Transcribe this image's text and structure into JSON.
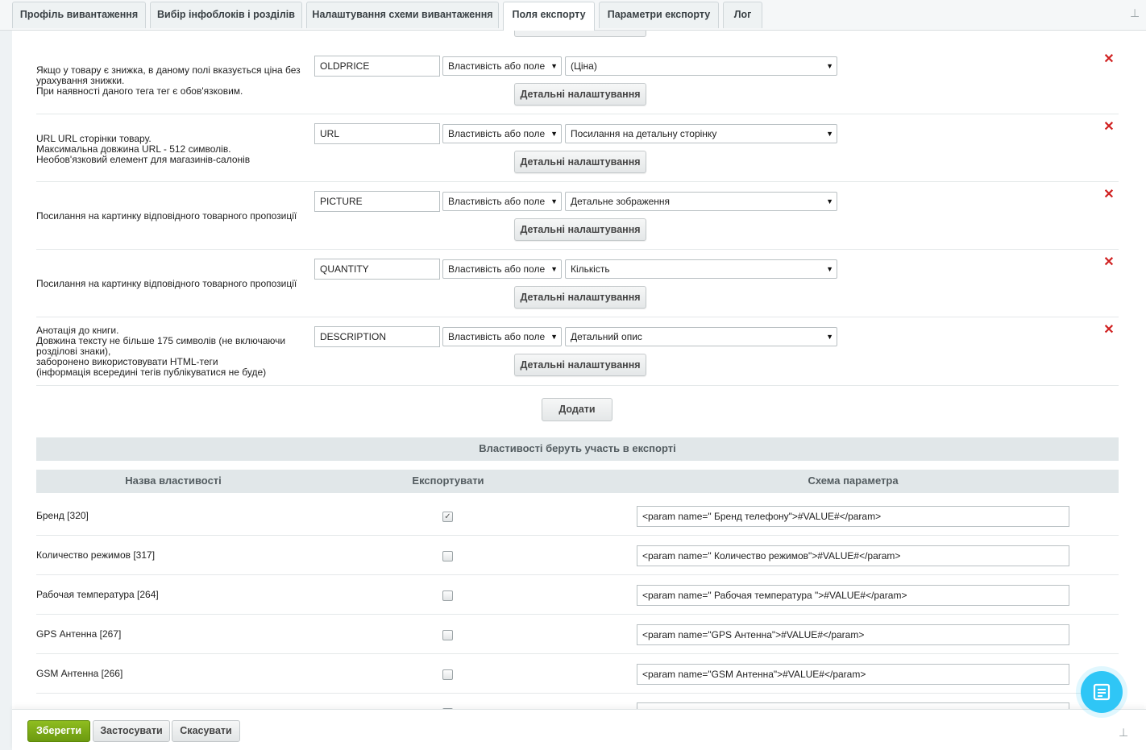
{
  "tabs": [
    {
      "label": "Профіль вивантаження"
    },
    {
      "label": "Вибір інфоблоків і розділів"
    },
    {
      "label": "Налаштування схеми вивантаження"
    },
    {
      "label": "Поля експорту"
    },
    {
      "label": "Параметри експорту"
    },
    {
      "label": "Лог"
    }
  ],
  "fields": [
    {
      "description": "Якщо у товару є знижка, в даному полі вказується ціна без урахування знижки.\nПри наявності даного тега тег є обов'язковим.",
      "tag": "OLDPRICE",
      "source_type": "Властивість або поле",
      "source_value": "(Ціна)",
      "details_label": "Детальні налаштування"
    },
    {
      "description": "URL URL сторінки товару.\nМаксимальна довжина URL - 512 символів.\nНеобов'язковий елемент для магазинів-салонів",
      "tag": "URL",
      "source_type": "Властивість або поле",
      "source_value": "Посилання на детальну сторінку",
      "details_label": "Детальні налаштування"
    },
    {
      "description": "Посилання на картинку відповідного товарного пропозиції",
      "tag": "PICTURE",
      "source_type": "Властивість або поле",
      "source_value": "Детальне зображення",
      "details_label": "Детальні налаштування"
    },
    {
      "description": "Посилання на картинку відповідного товарного пропозиції",
      "tag": "QUANTITY",
      "source_type": "Властивість або поле",
      "source_value": "Кількість",
      "details_label": "Детальні налаштування"
    },
    {
      "description": "Анотація до книги.\nДовжина тексту не більше 175 символів (не включаючи розділові знаки),\nзаборонено використовувати HTML-теги\n(інформація всередині тегів публікуватися не буде)",
      "tag": "DESCRIPTION",
      "source_type": "Властивість або поле",
      "source_value": "Детальний опис",
      "details_label": "Детальні налаштування"
    }
  ],
  "add_label": "Додати",
  "properties_section": {
    "title": "Властивості беруть участь в експорті",
    "headers": {
      "name": "Назва властивості",
      "export": "Експортувати",
      "schema": "Схема параметра"
    },
    "rows": [
      {
        "name": "Бренд [320]",
        "checked": true,
        "schema": "<param name=\" Бренд телефону\">#VALUE#</param>"
      },
      {
        "name": "Количество режимов [317]",
        "checked": false,
        "schema": "<param name=\" Количество режимов\">#VALUE#</param>"
      },
      {
        "name": "Рабочая температура [264]",
        "checked": false,
        "schema": "<param name=\" Рабочая температура \">#VALUE#</param>"
      },
      {
        "name": "GPS Антенна [267]",
        "checked": false,
        "schema": "<param name=\"GPS Антенна\">#VALUE#</param>"
      },
      {
        "name": "GSM Антенна [266]",
        "checked": false,
        "schema": "<param name=\"GSM Антенна\">#VALUE#</param>"
      }
    ]
  },
  "footer": {
    "save": "Зберегти",
    "apply": "Застосувати",
    "cancel": "Скасувати"
  },
  "colors": {
    "accent_green": "#7aab17",
    "delete_red": "#d02020",
    "chat_blue": "#2fc6f6",
    "header_gray": "#e1e7e9"
  },
  "icons": {
    "pin": "pin-icon",
    "delete": "close-icon",
    "chat": "chat-icon",
    "dropdown": "chevron-down-icon"
  }
}
